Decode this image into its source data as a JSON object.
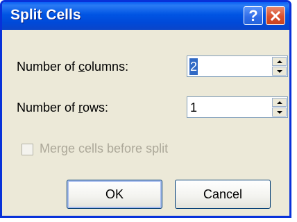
{
  "dialog": {
    "title": "Split Cells",
    "help_glyph": "?",
    "columns_label_pre": "Number of ",
    "columns_label_ul": "c",
    "columns_label_post": "olumns:",
    "columns_value": "2",
    "rows_label_pre": "Number of ",
    "rows_label_ul": "r",
    "rows_label_post": "ows:",
    "rows_value": "1",
    "merge_label": "Merge cells before split",
    "merge_checked": false,
    "ok_label": "OK",
    "cancel_label": "Cancel"
  },
  "colors": {
    "titlebar": "#0054E3",
    "dialog_bg": "#ECE9D8",
    "selection": "#316AC5",
    "close_button": "#D9502E"
  }
}
